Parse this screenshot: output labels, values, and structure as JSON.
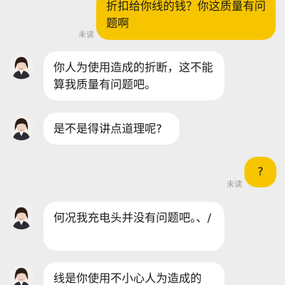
{
  "messages": [
    {
      "side": "out",
      "text": "折扣给你线的钱？你这质量有问题啊",
      "status": "未读"
    },
    {
      "side": "in",
      "text": "你人为使用造成的折断，这不能算我质量有问题吧。"
    },
    {
      "side": "in",
      "text": "是不是得讲点道理呢?"
    },
    {
      "side": "out",
      "text": "?",
      "status": "未读"
    },
    {
      "side": "in",
      "text": "何况我充电头并没有问题吧。、/"
    },
    {
      "side": "in",
      "text": "线是你使用不小心人为造成的"
    }
  ],
  "colors": {
    "background": "#ededed",
    "outgoing_bubble": "#f7c500",
    "incoming_bubble": "#ffffff",
    "status_text": "#9a9a9a"
  },
  "icons": {
    "contact_avatar": "woman-portrait-avatar"
  }
}
